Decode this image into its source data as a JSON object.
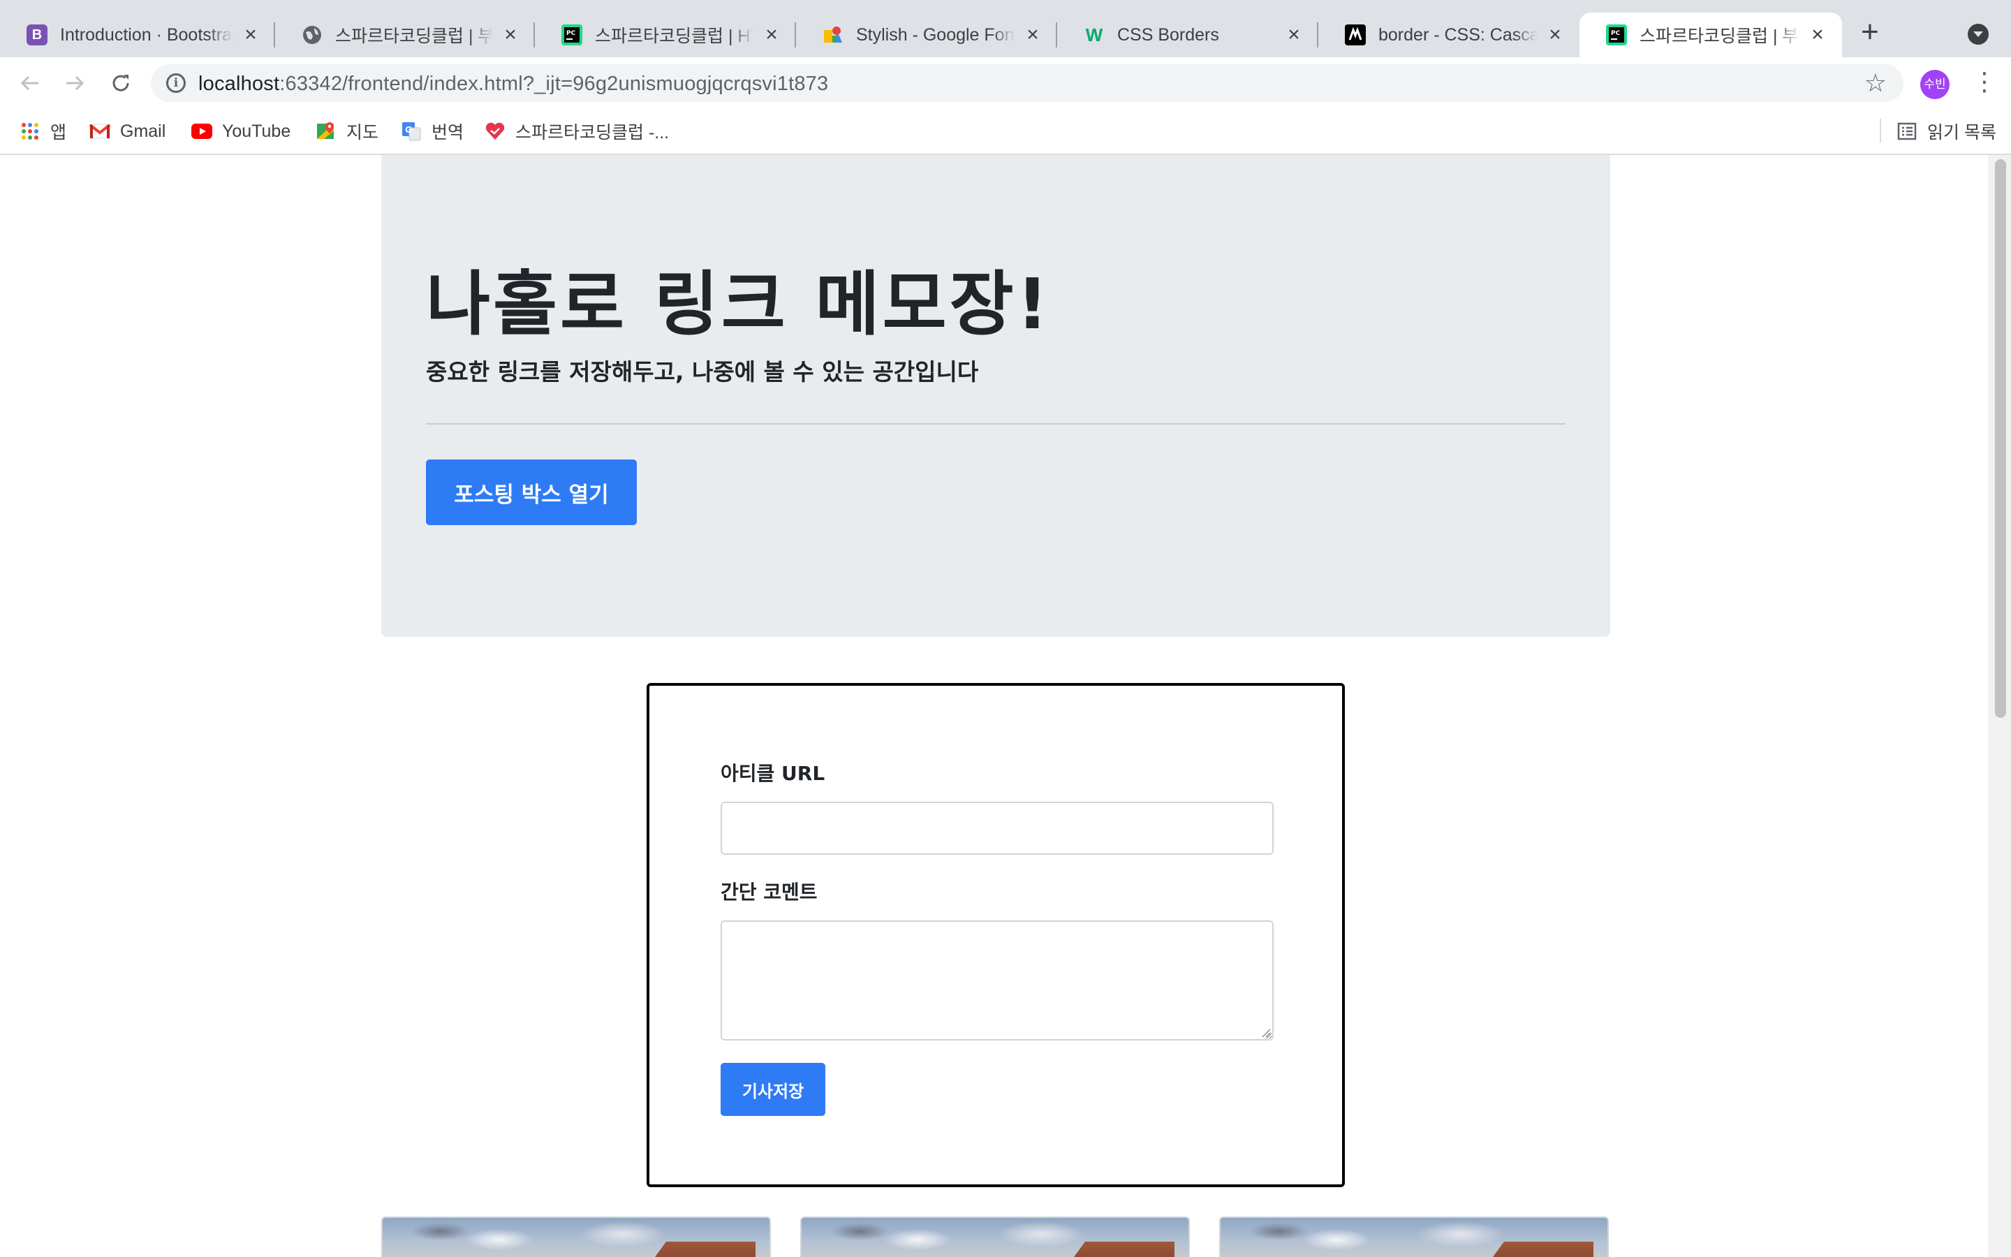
{
  "browser": {
    "tabs": [
      {
        "title": "Introduction · Bootstrap",
        "icon": "bootstrap-icon",
        "icon_color": "#7952b3",
        "icon_glyph": "B"
      },
      {
        "title": "스파르타코딩클럽 | 부트스트랩",
        "icon": "globe-icon",
        "icon_color": "#5f6368",
        "icon_glyph": ""
      },
      {
        "title": "스파르타코딩클럽 | HTML",
        "icon": "pycharm-icon",
        "icon_color": "#21d789",
        "icon_glyph": "PC"
      },
      {
        "title": "Stylish - Google Fonts",
        "icon": "google-fonts-icon",
        "icon_color": "#4285f4",
        "icon_glyph": ""
      },
      {
        "title": "CSS Borders",
        "icon": "w3schools-icon",
        "icon_color": "#04aa6d",
        "icon_glyph": "W"
      },
      {
        "title": "border - CSS: Cascading",
        "icon": "mdn-icon",
        "icon_color": "#000000",
        "icon_glyph": ""
      },
      {
        "title": "스파르타코딩클럽 | 부트스트랩",
        "icon": "pycharm-icon",
        "icon_color": "#21d789",
        "icon_glyph": "PC",
        "active": true
      }
    ],
    "address": {
      "host": "localhost",
      "rest": ":63342/frontend/index.html?_ijt=96g2unismuogjqcrqsvi1t873"
    },
    "profile_label": "수빈",
    "bookmarks": [
      {
        "label": "앱",
        "icon": "apps-grid-icon"
      },
      {
        "label": "Gmail",
        "icon": "gmail-icon"
      },
      {
        "label": "YouTube",
        "icon": "youtube-icon"
      },
      {
        "label": "지도",
        "icon": "maps-icon"
      },
      {
        "label": "번역",
        "icon": "translate-icon"
      },
      {
        "label": "스파르타코딩클럽 -...",
        "icon": "sparta-heart-icon"
      }
    ],
    "reading_list_label": "읽기 목록"
  },
  "page": {
    "jumbotron": {
      "title": "나홀로 링크 메모장!",
      "lead": "중요한 링크를 저장해두고, 나중에 볼 수 있는 공간입니다",
      "open_button": "포스팅 박스 열기"
    },
    "posting_box": {
      "url_label": "아티클 URL",
      "url_value": "",
      "comment_label": "간단 코멘트",
      "comment_value": "",
      "save_button": "기사저장"
    },
    "cards_count_visible": 3
  },
  "colors": {
    "accent": "#2f7bf5",
    "jumbotron_bg": "#e9ecef",
    "tabstrip_bg": "#dee1e6"
  }
}
